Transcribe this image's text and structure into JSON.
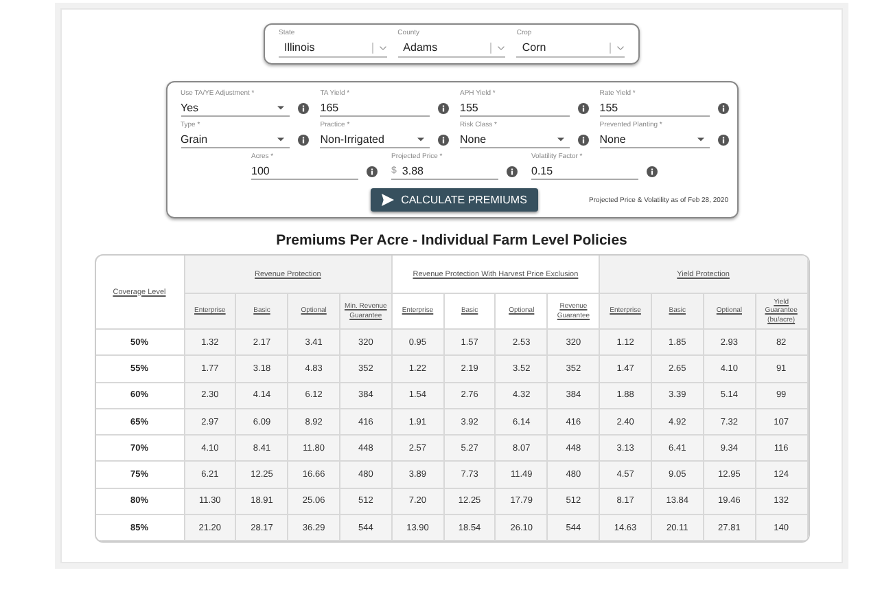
{
  "location": [
    {
      "label": "State",
      "value": "Illinois"
    },
    {
      "label": "County",
      "value": "Adams"
    },
    {
      "label": "Crop",
      "value": "Corn"
    }
  ],
  "form_rows": [
    [
      {
        "label": "Use TA/YE Adjustment *",
        "value": "Yes",
        "kind": "select"
      },
      {
        "label": "TA Yield *",
        "value": "165",
        "kind": "text"
      },
      {
        "label": "APH Yield *",
        "value": "155",
        "kind": "text"
      },
      {
        "label": "Rate Yield *",
        "value": "155",
        "kind": "text"
      }
    ],
    [
      {
        "label": "Type *",
        "value": "Grain",
        "kind": "select"
      },
      {
        "label": "Practice *",
        "value": "Non-Irrigated",
        "kind": "select"
      },
      {
        "label": "Risk Class *",
        "value": "None",
        "kind": "select"
      },
      {
        "label": "Prevented Planting *",
        "value": "None",
        "kind": "select"
      }
    ],
    [
      {
        "label": "Acres *",
        "value": "100",
        "kind": "text"
      },
      {
        "label": "Projected Price *",
        "prefix": "$",
        "value": "3.88",
        "kind": "text"
      },
      {
        "label": "Volatility Factor *",
        "value": "0.15",
        "kind": "text"
      }
    ]
  ],
  "calculate_button": "CALCULATE PREMIUMS",
  "price_note": "Projected Price & Volatility as of Feb 28, 2020",
  "table": {
    "title": "Premiums Per Acre - Individual Farm Level Policies",
    "corner": "Coverage Level",
    "groups": [
      {
        "name": "Revenue Protection",
        "columns": [
          "Enterprise",
          "Basic",
          "Optional",
          "Min. Revenue Guarantee"
        ]
      },
      {
        "name": "Revenue Protection With Harvest Price Exclusion",
        "columns": [
          "Enterprise",
          "Basic",
          "Optional",
          "Revenue Guarantee"
        ]
      },
      {
        "name": "Yield Protection",
        "columns": [
          "Enterprise",
          "Basic",
          "Optional",
          "Yield Guarantee (bu/acre)"
        ]
      }
    ],
    "rows": [
      {
        "level": "50%",
        "cells": [
          "1.32",
          "2.17",
          "3.41",
          "320",
          "0.95",
          "1.57",
          "2.53",
          "320",
          "1.12",
          "1.85",
          "2.93",
          "82"
        ]
      },
      {
        "level": "55%",
        "cells": [
          "1.77",
          "3.18",
          "4.83",
          "352",
          "1.22",
          "2.19",
          "3.52",
          "352",
          "1.47",
          "2.65",
          "4.10",
          "91"
        ]
      },
      {
        "level": "60%",
        "cells": [
          "2.30",
          "4.14",
          "6.12",
          "384",
          "1.54",
          "2.76",
          "4.32",
          "384",
          "1.88",
          "3.39",
          "5.14",
          "99"
        ]
      },
      {
        "level": "65%",
        "cells": [
          "2.97",
          "6.09",
          "8.92",
          "416",
          "1.91",
          "3.92",
          "6.14",
          "416",
          "2.40",
          "4.92",
          "7.32",
          "107"
        ]
      },
      {
        "level": "70%",
        "cells": [
          "4.10",
          "8.41",
          "11.80",
          "448",
          "2.57",
          "5.27",
          "8.07",
          "448",
          "3.13",
          "6.41",
          "9.34",
          "116"
        ]
      },
      {
        "level": "75%",
        "cells": [
          "6.21",
          "12.25",
          "16.66",
          "480",
          "3.89",
          "7.73",
          "11.49",
          "480",
          "4.57",
          "9.05",
          "12.95",
          "124"
        ]
      },
      {
        "level": "80%",
        "cells": [
          "11.30",
          "18.91",
          "25.06",
          "512",
          "7.20",
          "12.25",
          "17.79",
          "512",
          "8.17",
          "13.84",
          "19.46",
          "132"
        ]
      },
      {
        "level": "85%",
        "cells": [
          "21.20",
          "28.17",
          "36.29",
          "544",
          "13.90",
          "18.54",
          "26.10",
          "544",
          "14.63",
          "20.11",
          "27.81",
          "140"
        ]
      }
    ]
  }
}
